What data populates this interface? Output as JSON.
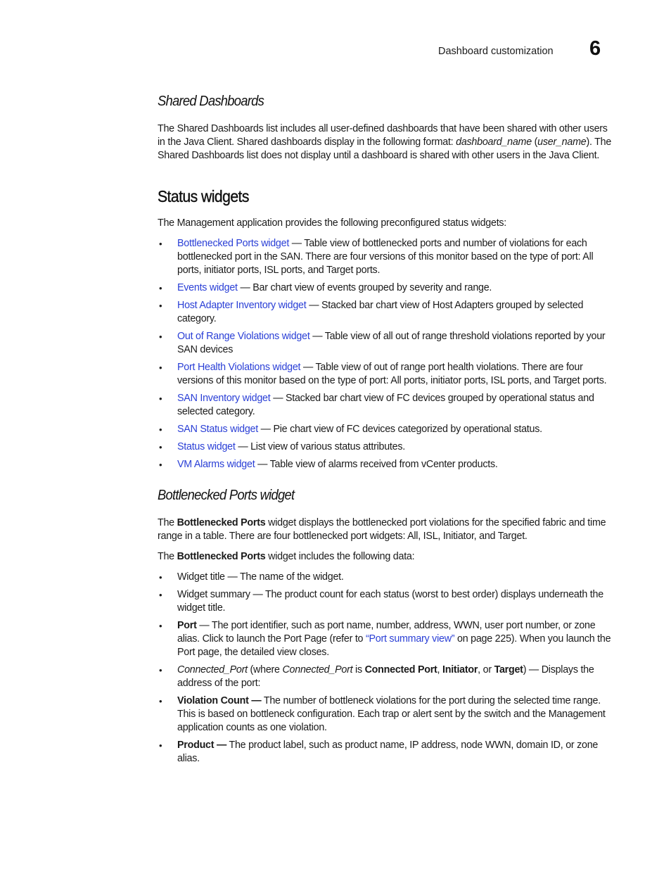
{
  "header": {
    "running_title": "Dashboard customization",
    "chapter_number": "6"
  },
  "shared_dashboards": {
    "heading": "Shared Dashboards",
    "para_1": "The Shared Dashboards list includes all user-defined dashboards that have been shared with other users in the Java Client. Shared dashboards display in the following format: ",
    "para_1_italic_1": "dashboard_name",
    "para_1_mid": " (",
    "para_1_italic_2": "user_name",
    "para_1_end": "). The Shared Dashboards list does not display until a dashboard is shared with other users in the Java Client."
  },
  "status_widgets": {
    "heading": "Status widgets",
    "intro": "The Management application provides the following preconfigured status widgets:",
    "items": [
      {
        "link": "Bottlenecked Ports widget",
        "text": " — Table view of bottlenecked ports and number of violations for each bottlenecked port in the SAN. There are four versions of this monitor based on the type of port: All ports, initiator ports, ISL ports, and Target ports."
      },
      {
        "link": "Events widget",
        "text": " — Bar chart view of events grouped by severity and range."
      },
      {
        "link": "Host Adapter Inventory widget",
        "text": " — Stacked bar chart view of Host Adapters grouped by selected category."
      },
      {
        "link": "Out of Range Violations widget",
        "text": " — Table view of all out of range threshold violations reported by your SAN devices"
      },
      {
        "link": "Port Health Violations widget",
        "text": " — Table view of out of range port health violations. There are four versions of this monitor based on the type of port: All ports, initiator ports, ISL ports, and Target ports."
      },
      {
        "link": "SAN Inventory widget",
        "text": " — Stacked bar chart view of FC devices grouped by operational status and selected category."
      },
      {
        "link": "SAN Status widget",
        "text": " — Pie chart view of FC devices categorized by operational status."
      },
      {
        "link": "Status widget",
        "text": " — List view of various status attributes."
      },
      {
        "link": "VM Alarms widget",
        "text": " — Table view of alarms received from vCenter products."
      }
    ]
  },
  "bottlenecked_ports": {
    "heading": "Bottlenecked Ports widget",
    "p1_pre": "The ",
    "p1_bold": "Bottlenecked Ports",
    "p1_post": " widget displays the bottlenecked port violations for the specified fabric and time range in a table. There are four bottlenecked port widgets: All, ISL, Initiator, and Target.",
    "p2_pre": "The ",
    "p2_bold": "Bottlenecked Ports",
    "p2_post": " widget includes the following data:",
    "items": {
      "widget_title": "Widget title — The name of the widget.",
      "widget_summary": "Widget summary — The product count for each status (worst to best order) displays underneath the widget title.",
      "port_bold": "Port",
      "port_text_1": " — The port identifier, such as port name, number, address, WWN, user port number, or zone alias. Click to launch the Port Page (refer to ",
      "port_link": "“Port summary view”",
      "port_text_2": " on page 225). When you launch the Port page, the detailed view closes.",
      "connected_italic_1": "Connected_Port",
      "connected_text_1": " (where ",
      "connected_italic_2": "Connected_Port",
      "connected_text_2": " is ",
      "connected_bold_1": "Connected Port",
      "connected_sep_1": ", ",
      "connected_bold_2": "Initiator",
      "connected_sep_2": ", or ",
      "connected_bold_3": "Target",
      "connected_text_3": ") — Displays the address of the port:",
      "violation_bold": "Violation Count —",
      "violation_text": " The number of bottleneck violations for the port during the selected time range. This is based on bottleneck configuration. Each trap or alert sent by the switch and the Management application counts as one violation.",
      "product_bold": "Product —",
      "product_text": " The product label, such as product name, IP address, node WWN, domain ID, or zone alias."
    }
  },
  "bullet_glyph": "•",
  "colors": {
    "link": "#2a3fd6",
    "text": "#1a1a1a"
  }
}
